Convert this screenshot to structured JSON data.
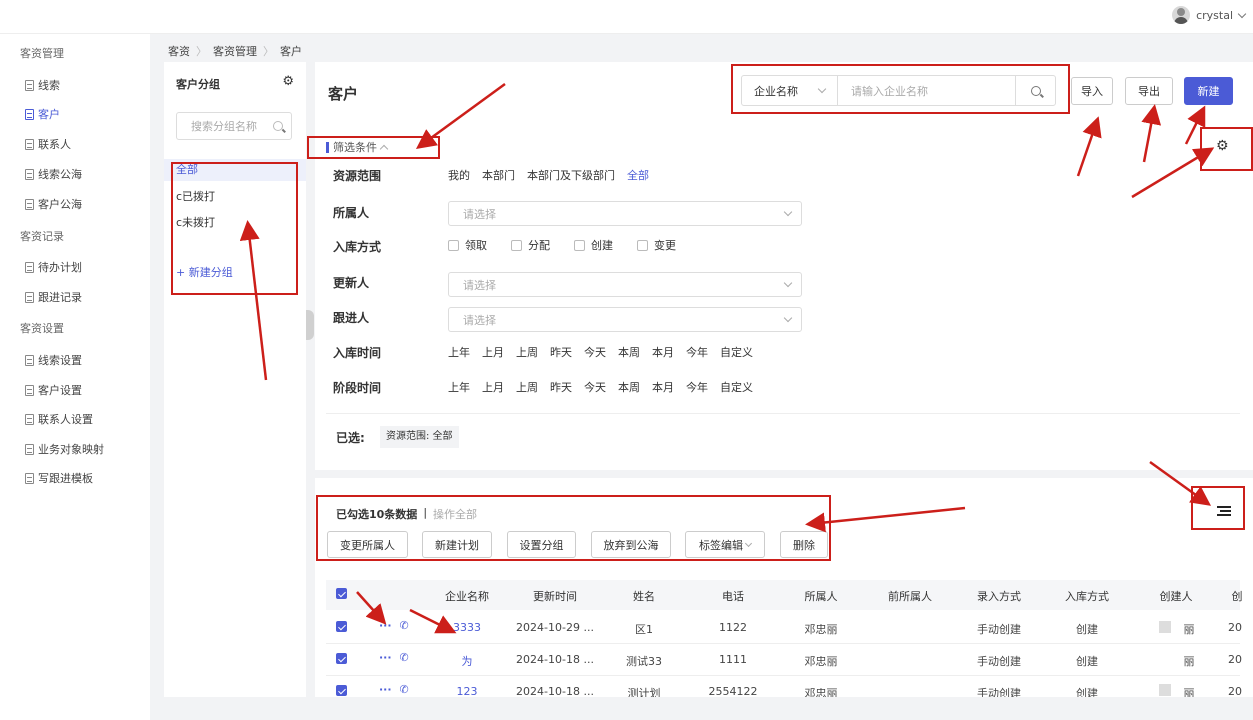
{
  "header": {
    "username": "crystal"
  },
  "sidebar": {
    "groups": [
      "客资管理",
      "客资记录",
      "客资设置"
    ],
    "items": [
      "线索",
      "客户",
      "联系人",
      "线索公海",
      "客户公海",
      "待办计划",
      "跟进记录",
      "线索设置",
      "客户设置",
      "联系人设置",
      "业务对象映射",
      "写跟进模板"
    ]
  },
  "breadcrumb": [
    "客资",
    "客资管理",
    "客户"
  ],
  "group_panel": {
    "title": "客户分组",
    "search_placeholder": "搜索分组名称",
    "items": [
      "全部",
      "c已拨打",
      "c未拨打"
    ],
    "new_group": "+ 新建分组"
  },
  "page": {
    "title": "客户"
  },
  "search": {
    "field": "企业名称",
    "placeholder": "请输入企业名称"
  },
  "toolbar": {
    "import": "导入",
    "export": "导出",
    "new": "新建"
  },
  "filters": {
    "toggle": "筛选条件",
    "labels": [
      "资源范围",
      "所属人",
      "入库方式",
      "更新人",
      "跟进人",
      "入库时间",
      "阶段时间"
    ],
    "scope_options": [
      "我的",
      "本部门",
      "本部门及下级部门",
      "全部"
    ],
    "select_placeholder": "请选择",
    "entry_methods": [
      "领取",
      "分配",
      "创建",
      "变更"
    ],
    "time_options": [
      "上年",
      "上月",
      "上周",
      "昨天",
      "今天",
      "本周",
      "本月",
      "今年",
      "自定义"
    ]
  },
  "chosen": {
    "label": "已选:",
    "tag": "资源范围: 全部"
  },
  "batch": {
    "selected_text": "已勾选10条数据",
    "separator": "|",
    "operate_all": "操作全部",
    "buttons": [
      "变更所属人",
      "新建计划",
      "设置分组",
      "放弃到公海",
      "标签编辑",
      "删除"
    ]
  },
  "table": {
    "columns": [
      "企业名称",
      "更新时间",
      "姓名",
      "电话",
      "所属人",
      "前所属人",
      "录入方式",
      "入库方式",
      "创建人",
      "创"
    ],
    "rows": [
      {
        "company": "3333",
        "updated": "2024-10-29 ...",
        "name": "区1",
        "phone": "1122",
        "owner": "邓忠丽",
        "prev_owner": "",
        "input": "手动创建",
        "entry": "创建",
        "creator": "丽",
        "created": "20"
      },
      {
        "company": "为",
        "updated": "2024-10-18 ...",
        "name": "测试33",
        "phone": "1111",
        "owner": "邓忠丽",
        "prev_owner": "",
        "input": "手动创建",
        "entry": "创建",
        "creator": "丽",
        "created": "20"
      },
      {
        "company": "123",
        "updated": "2024-10-18 ...",
        "name": "测计划",
        "phone": "2554122",
        "owner": "邓忠丽",
        "prev_owner": "",
        "input": "手动创建",
        "entry": "创建",
        "creator": "丽",
        "created": "20"
      }
    ],
    "ops_more": "···"
  },
  "colors": {
    "accent": "#4b5bd6",
    "annotation": "#cc1f1a",
    "page_bg": "#f2f3f5"
  },
  "icons": [
    "gear-icon",
    "search-icon",
    "chevron-down-icon",
    "chevron-up-icon",
    "phone-icon",
    "more-icon",
    "list-settings-icon",
    "avatar"
  ]
}
